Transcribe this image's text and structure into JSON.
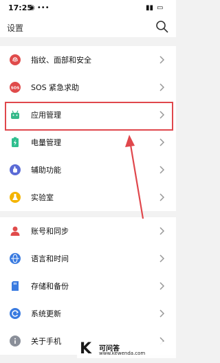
{
  "status_bar": {
    "time": "17:25",
    "battery_icon": "battery-icon",
    "signal_icon": "signal-icon"
  },
  "header": {
    "title": "设置",
    "search_icon": "search-icon"
  },
  "groups": [
    {
      "items": [
        {
          "label": "指纹、面部和安全",
          "icon": "fingerprint-icon",
          "color": "#e04b4b"
        },
        {
          "label": "SOS 紧急求助",
          "icon": "sos-icon",
          "color": "#e04b4b"
        },
        {
          "label": "应用管理",
          "icon": "android-icon",
          "color": "#35b98a"
        },
        {
          "label": "电量管理",
          "icon": "battery-icon",
          "color": "#2fbf8f"
        },
        {
          "label": "辅助功能",
          "icon": "hand-icon",
          "color": "#5b6bd6"
        },
        {
          "label": "实验室",
          "icon": "flask-icon",
          "color": "#f4b400"
        }
      ]
    },
    {
      "items": [
        {
          "label": "账号和同步",
          "icon": "person-icon",
          "color": "#e04b4b"
        },
        {
          "label": "语言和时间",
          "icon": "globe-icon",
          "color": "#3a7be0"
        },
        {
          "label": "存储和备份",
          "icon": "storage-icon",
          "color": "#3a7be0"
        },
        {
          "label": "系统更新",
          "icon": "update-icon",
          "color": "#3a7be0"
        },
        {
          "label": "关于手机",
          "icon": "info-icon",
          "color": "#8a8f99"
        }
      ]
    }
  ],
  "annotation": {
    "color": "#e0474c"
  },
  "watermark": {
    "logo": "K",
    "title": "可问答",
    "url": "www.kewenda.com"
  }
}
